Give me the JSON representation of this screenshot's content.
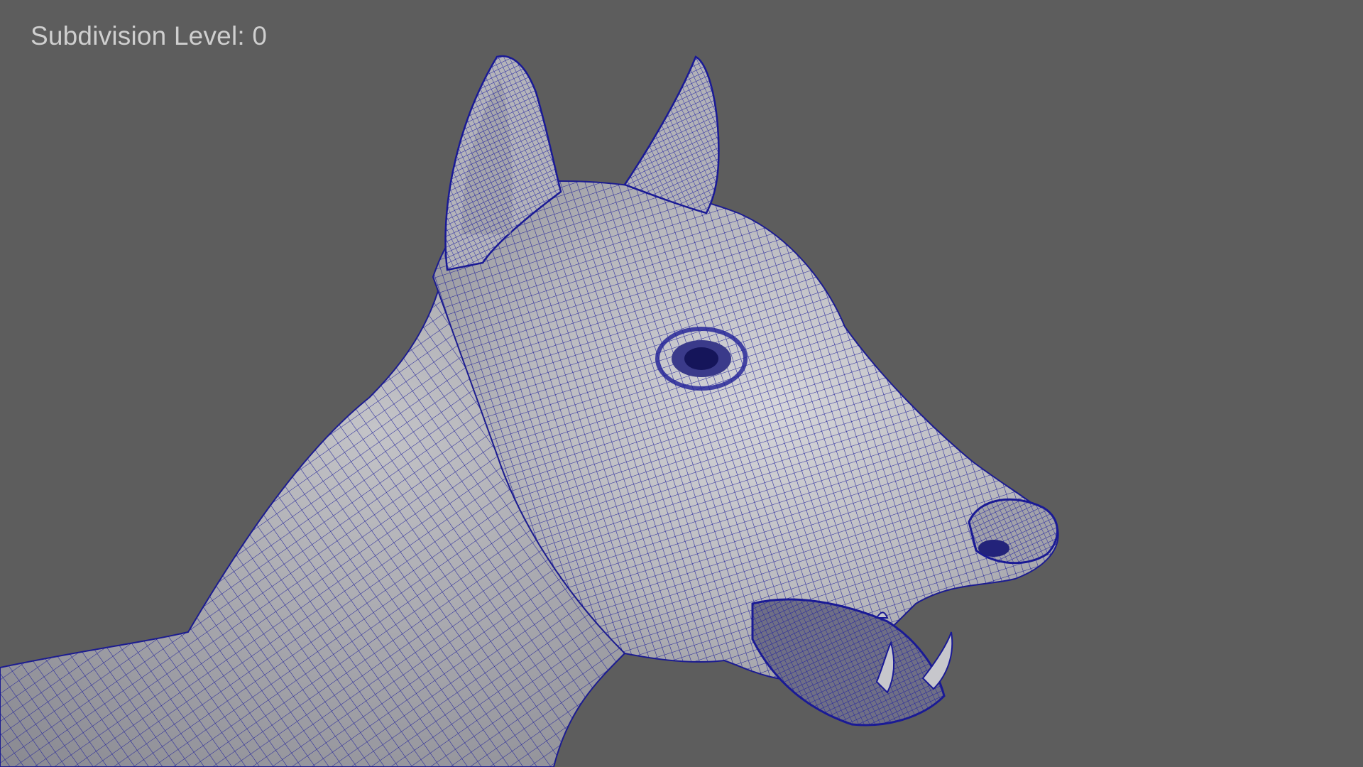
{
  "viewport": {
    "hud": {
      "subdivision_label": "Subdivision Level: 0"
    },
    "model": {
      "subject": "dog-head-wireframe",
      "shading": "smooth-shaded with wireframe overlay"
    }
  },
  "colors": {
    "background": "#5d5d5d",
    "surface": "#b9b9bd",
    "wireframe": "#1c1c9c",
    "hud_text": "#cfcfcf"
  }
}
